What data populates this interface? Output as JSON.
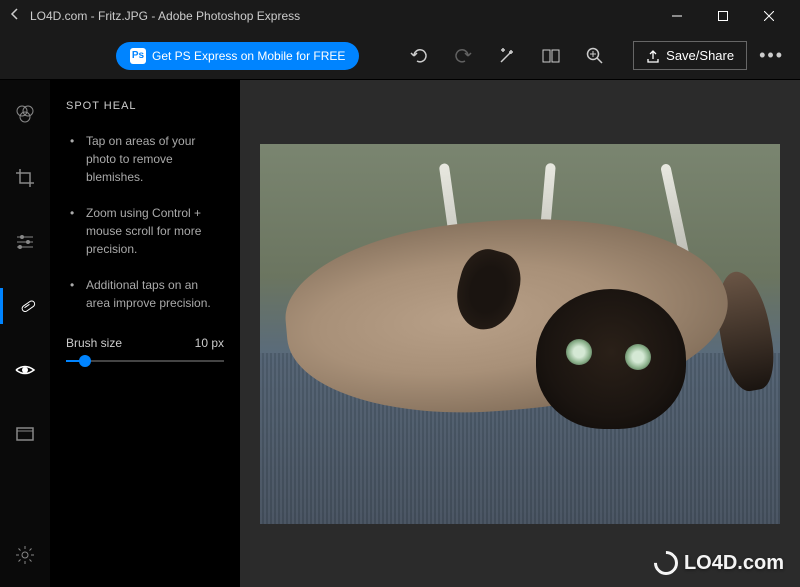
{
  "window": {
    "title": "LO4D.com - Fritz.JPG - Adobe Photoshop Express"
  },
  "topbar": {
    "promo_label": "Get PS Express on Mobile for FREE",
    "save_label": "Save/Share"
  },
  "tools": [
    {
      "name": "looks",
      "label": "Looks"
    },
    {
      "name": "crop",
      "label": "Crop"
    },
    {
      "name": "adjust",
      "label": "Adjustments"
    },
    {
      "name": "spot-heal",
      "label": "Spot Heal",
      "active": true
    },
    {
      "name": "eye",
      "label": "Remove Red Eye"
    },
    {
      "name": "border",
      "label": "Border"
    }
  ],
  "panel": {
    "title": "SPOT HEAL",
    "tips": [
      "Tap on areas of your photo to remove blemishes.",
      "Zoom using Control + mouse scroll for more precision.",
      "Additional taps on an area improve precision."
    ],
    "brush_label": "Brush size",
    "brush_value": "10 px",
    "brush_percent": 12
  },
  "watermark": "LO4D.com"
}
